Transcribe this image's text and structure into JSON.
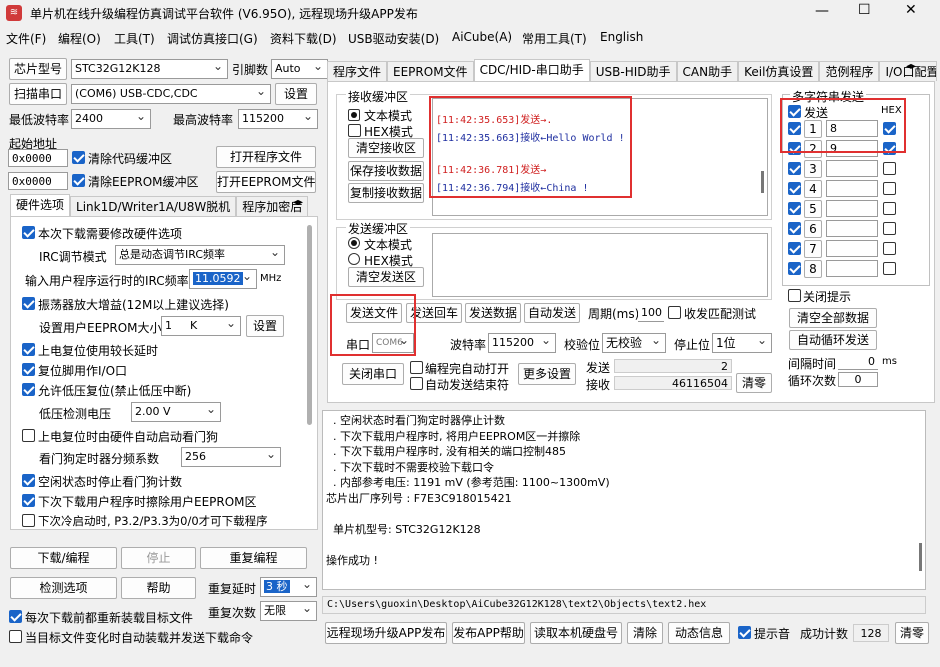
{
  "window": {
    "title": "单片机在线升级编程仿真调试平台软件 (V6.95O), 远程现场升级APP发布",
    "controls": {
      "minimize": "—",
      "maximize": "☐",
      "close": "✕"
    }
  },
  "menu": [
    "文件(F)",
    "编程(O)",
    "工具(T)",
    "调试仿真接口(G)",
    "资料下载(D)",
    "USB驱动安装(D)",
    "AiCube(A)",
    "常用工具(T)",
    "English"
  ],
  "left": {
    "chip_label": "芯片型号",
    "chip_value": "STC32G12K128",
    "baud_head_label": "引脚数",
    "pin_value": "Auto",
    "scan_button": "扫描串口",
    "port_value": "(COM6) USB-CDC,CDC",
    "settings_button": "设置",
    "min_baud_label": "最低波特率",
    "min_baud_value": "2400",
    "max_baud_label": "最高波特率",
    "max_baud_value": "115200",
    "start_addr_label": "起始地址",
    "addr1": "0x0000",
    "clear_code_label": "清除代码缓冲区",
    "open_program_button": "打开程序文件",
    "addr2": "0x0000",
    "clear_eeprom_label": "清除EEPROM缓冲区",
    "open_eeprom_button": "打开EEPROM文件",
    "tabs": [
      "硬件选项",
      "Link1D/Writer1A/U8W脱机",
      "程序加密后"
    ],
    "options": {
      "o1": "本次下载需要修改硬件选项",
      "irc_mode_label": "IRC调节模式",
      "irc_mode_value": "总是动态调节IRC频率",
      "irc_freq_label": "输入用户程序运行时的IRC频率",
      "irc_freq_value": "11.0592",
      "irc_unit": "MHz",
      "o2": "振荡器放大增益(12M以上建议选择)",
      "eeprom_size_label": "设置用户EEPROM大小",
      "eeprom_size_value": "1",
      "eeprom_size_unit": "K",
      "eeprom_set_button": "设置",
      "o3": "上电复位使用较长延时",
      "o4": "复位脚用作I/O口",
      "o5": "允许低压复位(禁止低压中断)",
      "lvd_label": "低压检测电压",
      "lvd_value": "2.00 V",
      "o6": "上电复位时由硬件自动启动看门狗",
      "wdt_label": "看门狗定时器分频系数",
      "wdt_value": "256",
      "o7": "空闲状态时停止看门狗计数",
      "o8": "下次下载用户程序时擦除用户EEPROM区",
      "o9": "下次冷启动时, P3.2/P3.3为0/0才可下载程序"
    },
    "download_button": "下载/编程",
    "stop_button": "停止",
    "reprogram_button": "重复编程",
    "check_button": "检测选项",
    "help_button": "帮助",
    "repeat_delay_label": "重复延时",
    "repeat_delay_value": "3 秒",
    "repeat_count_label": "重复次数",
    "repeat_count_value": "无限",
    "reload_label": "每次下载前都重新装载目标文件",
    "auto_send_label": "当目标文件变化时自动装载并发送下载命令"
  },
  "right_tabs": [
    "程序文件",
    "EEPROM文件",
    "CDC/HID-串口助手",
    "USB-HID助手",
    "CAN助手",
    "Keil仿真设置",
    "范例程序",
    "I/O口配置"
  ],
  "serial": {
    "recv_group": "接收缓冲区",
    "text_mode": "文本模式",
    "hex_mode": "HEX模式",
    "clear_recv": "清空接收区",
    "save_recv": "保存接收数据",
    "copy_recv": "复制接收数据",
    "log": [
      {
        "time": "[11:42:35.653]",
        "dir": "发送→",
        "msg": ".",
        "color": "#d02020"
      },
      {
        "time": "[11:42:35.663]",
        "dir": "接收←",
        "msg": "Hello World !",
        "color": "#1f2fa0"
      },
      {
        "time": "[11:42:36.781]",
        "dir": "发送→",
        "msg": "",
        "color": "#d02020"
      },
      {
        "time": "[11:42:36.794]",
        "dir": "接收←",
        "msg": "China !",
        "color": "#1f2fa0"
      }
    ],
    "send_group": "发送缓冲区",
    "send_text_mode": "文本模式",
    "send_hex_mode": "HEX模式",
    "clear_send": "清空发送区",
    "send_file": "发送文件",
    "send_enter": "发送回车",
    "send_data": "发送数据",
    "auto_send": "自动发送",
    "period_label": "周期(ms)",
    "period_value": "100",
    "match_label": "收发匹配测试",
    "port_label": "串口",
    "port_value": "COM6",
    "baud_label": "波特率",
    "baud_value": "115200",
    "parity_label": "校验位",
    "parity_value": "无校验",
    "stop_label": "停止位",
    "stop_value": "1位",
    "close_port": "关闭串口",
    "auto_open_label": "编程完自动打开",
    "auto_end_label": "自动发送结束符",
    "more_settings": "更多设置",
    "send_count_label": "发送",
    "send_count": "2",
    "recv_count_label": "接收",
    "recv_count": "46116504",
    "clear_count": "清零"
  },
  "multi": {
    "title": "多字符串发送",
    "send_header": "发送",
    "hex_header": "HEX",
    "rows": [
      {
        "n": "1",
        "value": "8",
        "checked": true,
        "hex": true
      },
      {
        "n": "2",
        "value": "9",
        "checked": true,
        "hex": true
      },
      {
        "n": "3",
        "value": "",
        "checked": true,
        "hex": false
      },
      {
        "n": "4",
        "value": "",
        "checked": true,
        "hex": false
      },
      {
        "n": "5",
        "value": "",
        "checked": true,
        "hex": false
      },
      {
        "n": "6",
        "value": "",
        "checked": true,
        "hex": false
      },
      {
        "n": "7",
        "value": "",
        "checked": true,
        "hex": false
      },
      {
        "n": "8",
        "value": "",
        "checked": true,
        "hex": false
      }
    ],
    "close_hint": "关闭提示",
    "clear_all": "清空全部数据",
    "auto_loop": "自动循环发送",
    "interval_label": "间隔时间",
    "interval_value": "0",
    "interval_unit": "ms",
    "loop_count_label": "循环次数",
    "loop_count_value": "0"
  },
  "output": {
    "lines": [
      "  . 空闲状态时看门狗定时器停止计数",
      "  . 下次下载用户程序时, 将用户EEPROM区一并擦除",
      "  . 下次下载用户程序时, 没有相关的端口控制485",
      "  . 下次下载时不需要校验下载口令",
      "  . 内部参考电压: 1191 mV (参考范围: 1100~1300mV)",
      "芯片出厂序列号 : F7E3C918015421",
      "",
      "  单片机型号: STC32G12K128",
      "",
      "操作成功 !"
    ],
    "path": "C:\\Users\\guoxin\\Desktop\\AiCube32G12K128\\text2\\Objects\\text2.hex"
  },
  "bottom": {
    "remote_publish": "远程现场升级APP发布",
    "publish_help": "发布APP帮助",
    "read_serial": "读取本机硬盘号",
    "clear": "清除",
    "animation": "动态信息",
    "beep_label": "提示音",
    "success_label": "成功计数",
    "success_count": "128",
    "clear_zero": "清零"
  }
}
